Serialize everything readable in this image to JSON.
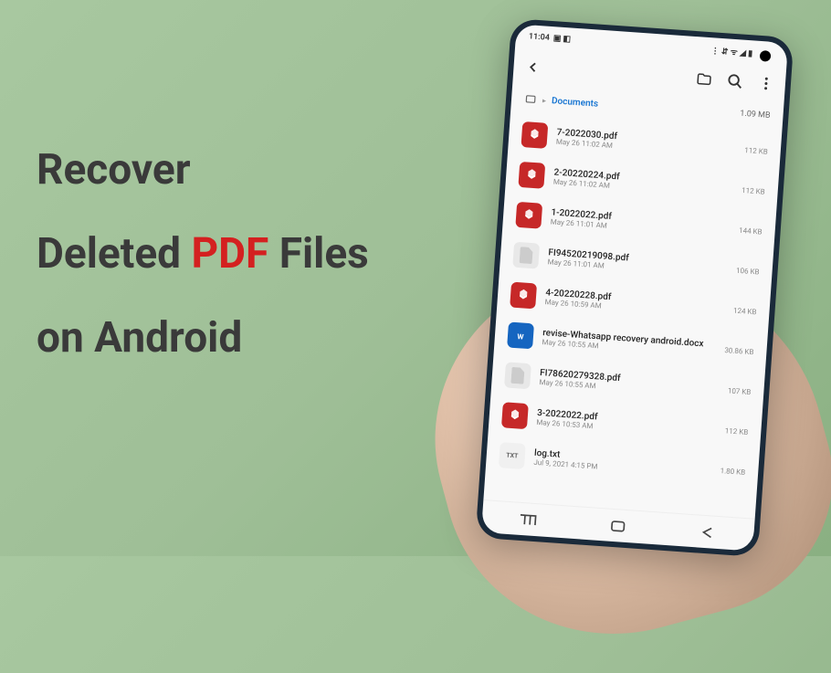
{
  "headline": {
    "line1": "Recover",
    "line2_pre": "Deleted ",
    "line2_highlight": "PDF",
    "line2_post": " Files",
    "line3": "on Android"
  },
  "status_bar": {
    "time": "11:04",
    "indicators_left": "▣ ◧",
    "indicators_right": "⋮ ⇵ ᯤ ◢ ▮"
  },
  "breadcrumb": {
    "root_icon": "⌂",
    "separator": "▸",
    "folder": "Documents",
    "total_size": "1.09 MB"
  },
  "files": [
    {
      "name": "7-2022030.pdf",
      "date": "May 26 11:02 AM",
      "size": "112 KB",
      "type": "pdf"
    },
    {
      "name": "2-20220224.pdf",
      "date": "May 26 11:02 AM",
      "size": "112 KB",
      "type": "pdf"
    },
    {
      "name": "1-2022022.pdf",
      "date": "May 26 11:01 AM",
      "size": "144 KB",
      "type": "pdf"
    },
    {
      "name": "FI94520219098.pdf",
      "date": "May 26 11:01 AM",
      "size": "106 KB",
      "type": "blank"
    },
    {
      "name": "4-20220228.pdf",
      "date": "May 26 10:59 AM",
      "size": "124 KB",
      "type": "pdf"
    },
    {
      "name": "revise-Whatsapp recovery android.docx",
      "date": "May 26 10:55 AM",
      "size": "30.86 KB",
      "type": "docx"
    },
    {
      "name": "FI78620279328.pdf",
      "date": "May 26 10:55 AM",
      "size": "107 KB",
      "type": "blank"
    },
    {
      "name": "3-2022022.pdf",
      "date": "May 26 10:53 AM",
      "size": "112 KB",
      "type": "pdf"
    },
    {
      "name": "log.txt",
      "date": "Jul 9, 2021 4:15 PM",
      "size": "1.80 KB",
      "type": "txt"
    }
  ]
}
